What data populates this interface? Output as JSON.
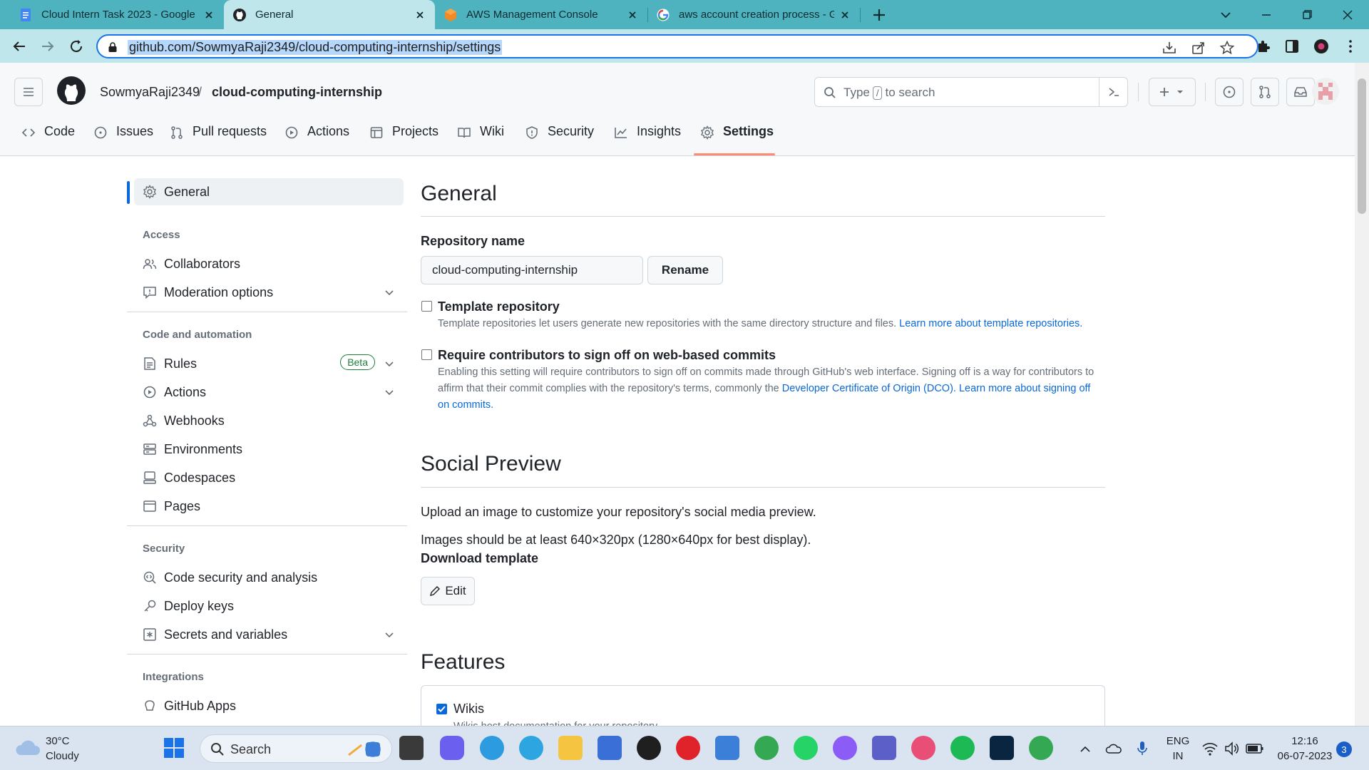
{
  "browser": {
    "tabs": [
      {
        "title": "Cloud Intern Task 2023 - Google",
        "active": false,
        "icon": "google-docs-icon"
      },
      {
        "title": "General",
        "active": true,
        "icon": "github-icon"
      },
      {
        "title": "AWS Management Console",
        "active": false,
        "icon": "aws-icon"
      },
      {
        "title": "aws account creation process - G",
        "active": false,
        "icon": "google-icon"
      }
    ],
    "url": "github.com/SowmyaRaji2349/cloud-computing-internship/settings"
  },
  "header": {
    "owner": "SowmyaRaji2349",
    "slash": "/",
    "repo": "cloud-computing-internship",
    "search_prefix": "Type",
    "search_key": "/",
    "search_suffix": "to search",
    "nav": [
      {
        "label": "Code",
        "icon": "code-icon"
      },
      {
        "label": "Issues",
        "icon": "issue-icon"
      },
      {
        "label": "Pull requests",
        "icon": "pull-request-icon"
      },
      {
        "label": "Actions",
        "icon": "play-icon"
      },
      {
        "label": "Projects",
        "icon": "table-icon"
      },
      {
        "label": "Wiki",
        "icon": "book-icon"
      },
      {
        "label": "Security",
        "icon": "shield-icon"
      },
      {
        "label": "Insights",
        "icon": "graph-icon"
      },
      {
        "label": "Settings",
        "icon": "gear-icon",
        "active": true
      }
    ]
  },
  "sidebar": {
    "general": "General",
    "access_heading": "Access",
    "collaborators": "Collaborators",
    "moderation": "Moderation options",
    "code_heading": "Code and automation",
    "rules": "Rules",
    "beta": "Beta",
    "actions": "Actions",
    "webhooks": "Webhooks",
    "environments": "Environments",
    "codespaces": "Codespaces",
    "pages": "Pages",
    "security_heading": "Security",
    "code_security": "Code security and analysis",
    "deploy_keys": "Deploy keys",
    "secrets": "Secrets and variables",
    "integrations_heading": "Integrations",
    "github_apps": "GitHub Apps"
  },
  "main": {
    "general_title": "General",
    "repo_name_label": "Repository name",
    "repo_name_value": "cloud-computing-internship",
    "rename": "Rename",
    "template_title": "Template repository",
    "template_desc": "Template repositories let users generate new repositories with the same directory structure and files.",
    "template_link": "Learn more about template repositories.",
    "signoff_title": "Require contributors to sign off on web-based commits",
    "signoff_desc_1": "Enabling this setting will require contributors to sign off on commits made through GitHub's web interface. Signing off is a way for contributors to affirm that their commit complies with the repository's terms, commonly the",
    "signoff_link_1": "Developer Certificate of Origin (DCO).",
    "signoff_link_2": "Learn more about signing off on commits.",
    "social_title": "Social Preview",
    "social_desc": "Upload an image to customize your repository's social media preview.",
    "social_size": "Images should be at least 640×320px (1280×640px for best display).",
    "download_template": "Download template",
    "edit": "Edit",
    "features_title": "Features",
    "wikis": "Wikis",
    "wikis_desc": "Wikis host documentation for your repository."
  },
  "taskbar": {
    "temp": "30°C",
    "condition": "Cloudy",
    "search": "Search",
    "lang_1": "ENG",
    "lang_2": "IN",
    "time": "12:16",
    "date": "06-07-2023",
    "notifications": "3"
  }
}
